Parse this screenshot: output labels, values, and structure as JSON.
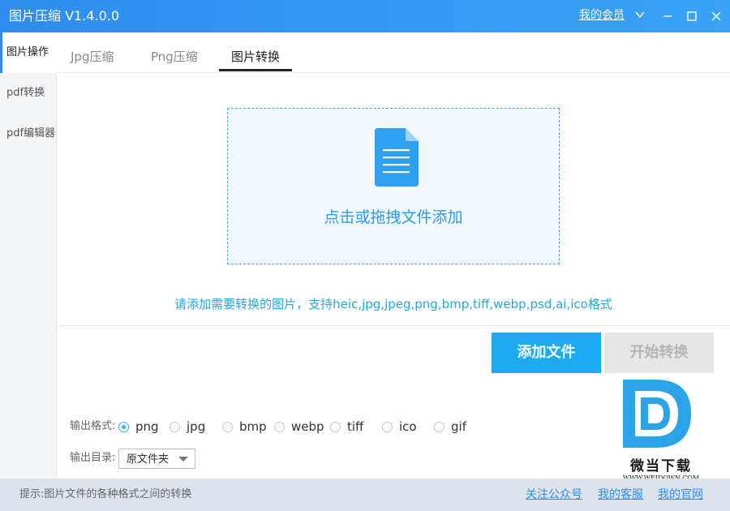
{
  "app": {
    "title": "图片压缩 V1.4.0.0",
    "member_link": "我的会员"
  },
  "sidebar": {
    "items": [
      {
        "label": "图片操作"
      },
      {
        "label": "pdf转换"
      },
      {
        "label": "pdf编辑器"
      }
    ]
  },
  "tabs": [
    {
      "label": "Jpg压缩"
    },
    {
      "label": "Png压缩"
    },
    {
      "label": "图片转换"
    }
  ],
  "dropzone": {
    "text": "点击或拖拽文件添加",
    "icon": "document-icon"
  },
  "hint": "请添加需要转换的图片，支持heic,jpg,jpeg,png,bmp,tiff,webp,psd,ai,ico格式",
  "buttons": {
    "add": "添加文件",
    "start": "开始转换"
  },
  "output": {
    "format_label": "输出格式:",
    "formats": [
      "png",
      "jpg",
      "bmp",
      "webp",
      "tiff",
      "ico",
      "gif"
    ],
    "selected_format": "png",
    "dir_label": "输出目录:",
    "dir_value": "原文件夹"
  },
  "watermark": {
    "name": "微当下载",
    "url": "WWW.WEIDOWN.COM"
  },
  "footer": {
    "tip": "提示:图片文件的各种格式之间的转换",
    "links": [
      "关注公众号",
      "我的客服",
      "我的官网"
    ]
  },
  "colors": {
    "accent": "#1eaaf1",
    "titlebar": "#2e8dee",
    "hint": "#2aa6d8",
    "disabled": "#e6e6e6"
  }
}
